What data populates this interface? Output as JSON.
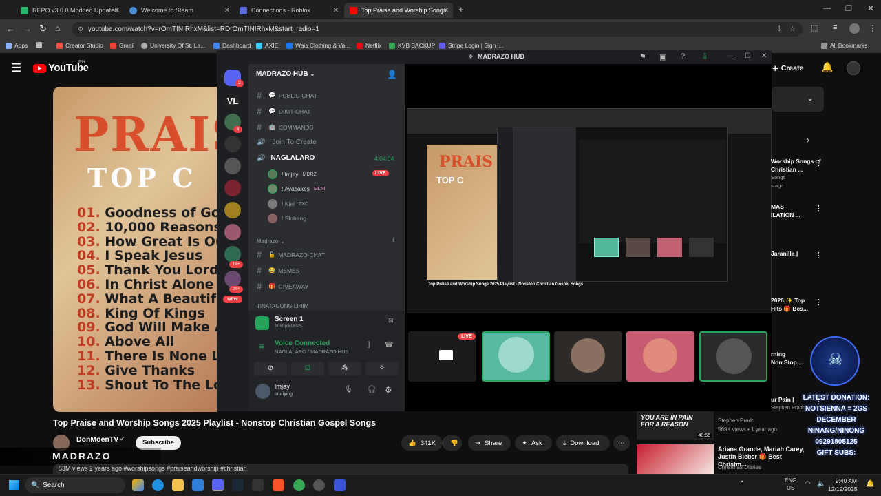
{
  "browser": {
    "tabs": [
      {
        "label": "REPO v3.0.0 Modded Updated",
        "color": "#29b86b"
      },
      {
        "label": "Welcome to Steam",
        "color": "#1b2838"
      },
      {
        "label": "Connections - Roblox",
        "color": "#5a6ee0"
      },
      {
        "label": "Top Praise and Worship Songs",
        "color": "#ff0000"
      }
    ],
    "url": "youtube.com/watch?v=rOmTINIRhxM&list=RDrOmTINIRhxM&start_radio=1",
    "bookmarks": [
      "Apps",
      "Creator Studio",
      "Gmail",
      "University Of St. La...",
      "Dashboard",
      "AXIE",
      "Wais Clothing & Va...",
      "Netflix",
      "KVB BACKUP",
      "Stripe Login | Sign i..."
    ],
    "all_bookmarks": "All Bookmarks"
  },
  "youtube": {
    "logo": "YouTube",
    "logo_country": "PH",
    "create": "Create",
    "thumb_title_1": "PRAIS",
    "thumb_title_2": "TOP C",
    "songs": [
      "Goodness of God",
      "10,000 Reasons",
      "How Great Is Our",
      "I Speak Jesus",
      "Thank You Lord",
      "In Christ Alone",
      "What A Beautiful",
      "King Of Kings",
      "God Will Make A Way",
      "Above All",
      "There Is None Like",
      "Give Thanks",
      "Shout To The Lord"
    ],
    "video_title": "Top Praise and Worship Songs 2025 Playlist - Nonstop Christian Gospel Songs",
    "channel": "DonMoenTV",
    "subscribe": "Subscribe",
    "likes": "341K",
    "share": "Share",
    "ask": "Ask",
    "download": "Download",
    "meta": "53M views  2 years ago  #worshipsongs #praiseandworship #christian",
    "watermark": "MADRAZO",
    "sidebar": [
      {
        "title": "Worship Songs of",
        "sub": "Christian ...",
        "ch": "Songs",
        "meta": "s ago"
      },
      {
        "title": "MAS",
        "sub": "ILATION ...",
        "ch": "",
        "meta": ""
      },
      {
        "title": "Jaranilla |",
        "sub": "",
        "ch": "",
        "meta": ""
      },
      {
        "title": "2026 ✨ Top",
        "sub": "Hits 🎁 Bes...",
        "ch": "",
        "meta": ""
      },
      {
        "title": "rning",
        "sub": "Non Stop ...",
        "ch": "",
        "meta": ""
      },
      {
        "title": "ur Pain |",
        "sub": "",
        "ch": "Stephen Prado",
        "meta": ""
      }
    ],
    "side_video_1": {
      "channel": "Stephen Prado",
      "meta": "569K views • 1 year ago",
      "duration": "48:55",
      "thumb_text": "YOU ARE IN PAIN FOR A REASON"
    },
    "side_video_2": {
      "title": "Ariana Grande, Mariah Carey, Justin Bieber 🎁 Best Christm...",
      "channel": "Christmas Diaries"
    },
    "donation": {
      "l1": "LATEST DONATION:",
      "l2": "NOTSIENNA = 2GS",
      "l3": "DECEMBER",
      "l4": "NINANG/NINONG",
      "l5": "09291805125",
      "l6": "GIFT SUBS:"
    }
  },
  "discord": {
    "window_title": "MADRAZO HUB",
    "server_name": "MADRAZO HUB",
    "server_badge": "2",
    "channels": [
      {
        "name": "PUBLIC-CHAT",
        "icon": "💬"
      },
      {
        "name": "DIKIT-CHAT",
        "icon": "💬"
      },
      {
        "name": "COMMANDS",
        "icon": "🤖"
      }
    ],
    "join_to_create": "Join To Create",
    "voice_channel": "NAGLALARO",
    "voice_timer": "4:04:04",
    "voice_users": [
      {
        "name": "! lmjay",
        "tag": "MDRZ",
        "live": "LIVE"
      },
      {
        "name": "! Avacakes",
        "tag": "MLNI",
        "live": ""
      },
      {
        "name": "! Kiel",
        "tag": "ZXC",
        "live": ""
      },
      {
        "name": "! Sloheng",
        "tag": "",
        "live": ""
      }
    ],
    "category": "Madrazo",
    "madrazo_channels": [
      {
        "name": "MADRAZO-CHAT",
        "icon": "🔒"
      },
      {
        "name": "MEMES",
        "icon": "😂"
      },
      {
        "name": "GIVEAWAY",
        "icon": "🎁"
      }
    ],
    "category_2": "TINATAGONG LIHIM",
    "screen_share": {
      "title": "Screen 1",
      "sub": "1080p 60FPS"
    },
    "voice_status": "Voice Connected",
    "voice_location": "NAGLALARO / MADRAZO HUB",
    "user": {
      "name": "lmjay",
      "status": "studying"
    },
    "server_badges": {
      "b1": "6",
      "b2": "1K+",
      "b3": "2K+",
      "new": "NEW"
    },
    "live_badge": "LIVE",
    "nested_title": "Top Praise and Worship Songs 2025 Playlist - Nonstop Christian Gospel Songs"
  },
  "taskbar": {
    "search": "Search",
    "lang": "ENG",
    "region": "US",
    "time": "9:40 AM",
    "date": "12/19/2025"
  }
}
